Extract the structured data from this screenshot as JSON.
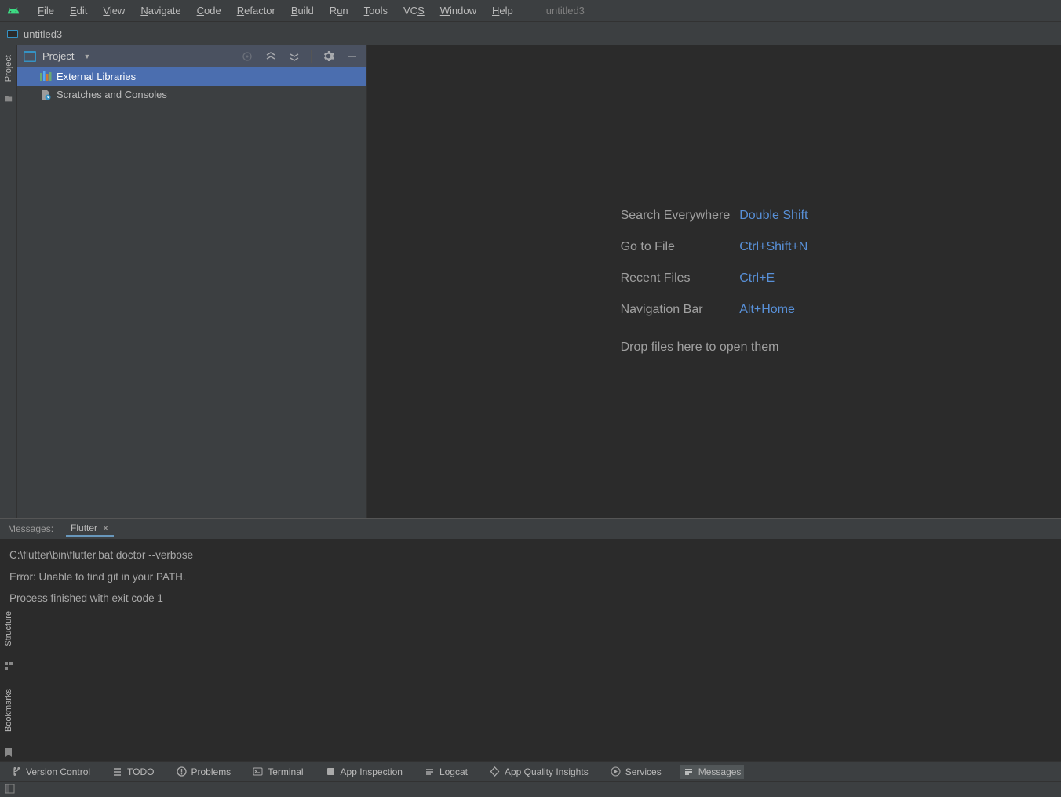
{
  "menubar": {
    "project_name": "untitled3",
    "items": [
      "File",
      "Edit",
      "View",
      "Navigate",
      "Code",
      "Refactor",
      "Build",
      "Run",
      "Tools",
      "VCS",
      "Window",
      "Help"
    ],
    "mnemonics": [
      "F",
      "E",
      "V",
      "N",
      "C",
      "R",
      "B",
      "u",
      "T",
      "S",
      "W",
      "H"
    ]
  },
  "navbar": {
    "project": "untitled3"
  },
  "left_rail": {
    "project_label": "Project"
  },
  "project_panel": {
    "title": "Project",
    "items": [
      {
        "label": "External Libraries",
        "selected": true
      },
      {
        "label": "Scratches and Consoles",
        "selected": false
      }
    ]
  },
  "editor": {
    "shortcuts": [
      {
        "label": "Search Everywhere",
        "key": "Double Shift"
      },
      {
        "label": "Go to File",
        "key": "Ctrl+Shift+N"
      },
      {
        "label": "Recent Files",
        "key": "Ctrl+E"
      },
      {
        "label": "Navigation Bar",
        "key": "Alt+Home"
      }
    ],
    "drop_hint": "Drop files here to open them"
  },
  "messages": {
    "panel_label": "Messages:",
    "active_tab": "Flutter",
    "lines": [
      "C:\\flutter\\bin\\flutter.bat doctor --verbose",
      "Error: Unable to find git in your PATH.",
      "Process finished with exit code 1"
    ]
  },
  "bottom_bar": {
    "items": [
      "Version Control",
      "TODO",
      "Problems",
      "Terminal",
      "App Inspection",
      "Logcat",
      "App Quality Insights",
      "Services",
      "Messages"
    ],
    "active": "Messages"
  },
  "side_rail_bottom": {
    "structure": "Structure",
    "bookmarks": "Bookmarks"
  }
}
